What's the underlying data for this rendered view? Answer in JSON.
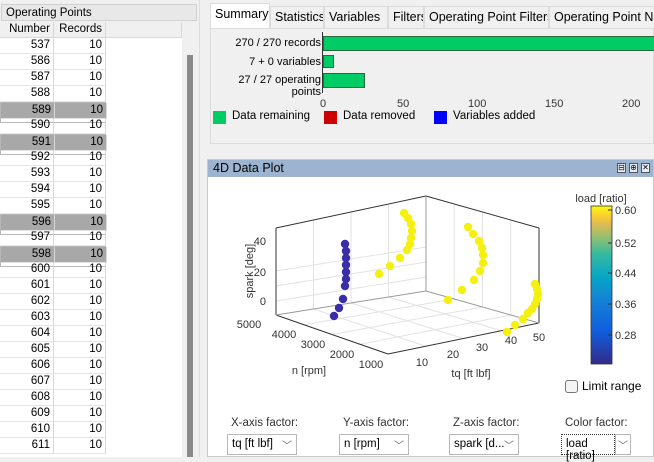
{
  "left_panel": {
    "title": "Operating Points",
    "columns": [
      "Number",
      "Records"
    ],
    "rows": [
      {
        "number": "537",
        "records": "10",
        "selected": false
      },
      {
        "number": "586",
        "records": "10",
        "selected": false
      },
      {
        "number": "587",
        "records": "10",
        "selected": false
      },
      {
        "number": "588",
        "records": "10",
        "selected": false
      },
      {
        "number": "589",
        "records": "10",
        "selected": true
      },
      {
        "number": "590",
        "records": "10",
        "selected": false
      },
      {
        "number": "591",
        "records": "10",
        "selected": true
      },
      {
        "number": "592",
        "records": "10",
        "selected": false
      },
      {
        "number": "593",
        "records": "10",
        "selected": false
      },
      {
        "number": "594",
        "records": "10",
        "selected": false
      },
      {
        "number": "595",
        "records": "10",
        "selected": false
      },
      {
        "number": "596",
        "records": "10",
        "selected": true
      },
      {
        "number": "597",
        "records": "10",
        "selected": false
      },
      {
        "number": "598",
        "records": "10",
        "selected": true
      },
      {
        "number": "600",
        "records": "10",
        "selected": false
      },
      {
        "number": "601",
        "records": "10",
        "selected": false
      },
      {
        "number": "602",
        "records": "10",
        "selected": false
      },
      {
        "number": "603",
        "records": "10",
        "selected": false
      },
      {
        "number": "604",
        "records": "10",
        "selected": false
      },
      {
        "number": "605",
        "records": "10",
        "selected": false
      },
      {
        "number": "606",
        "records": "10",
        "selected": false
      },
      {
        "number": "607",
        "records": "10",
        "selected": false
      },
      {
        "number": "608",
        "records": "10",
        "selected": false
      },
      {
        "number": "609",
        "records": "10",
        "selected": false
      },
      {
        "number": "610",
        "records": "10",
        "selected": false
      },
      {
        "number": "611",
        "records": "10",
        "selected": false
      }
    ]
  },
  "tabs": [
    {
      "label": "Summary",
      "active": true
    },
    {
      "label": "Statistics",
      "active": false
    },
    {
      "label": "Variables",
      "active": false
    },
    {
      "label": "Filters",
      "active": false
    },
    {
      "label": "Operating Point Filters",
      "active": false
    },
    {
      "label": "Operating Point No",
      "active": false
    }
  ],
  "summary": {
    "bars": [
      {
        "label": "270 / 270 records",
        "value": 270
      },
      {
        "label": "7 + 0 variables",
        "value": 7
      },
      {
        "label": "27 / 27 operating points",
        "value": 27
      }
    ],
    "ticks": [
      "0",
      "50",
      "100",
      "150",
      "200"
    ],
    "legend": [
      {
        "label": "Data remaining",
        "color": "#00cc66"
      },
      {
        "label": "Data removed",
        "color": "#cc0000"
      },
      {
        "label": "Variables added",
        "color": "#0000ff"
      }
    ]
  },
  "plot_panel": {
    "title": "4D Data Plot",
    "buttons": [
      "undock",
      "maximize",
      "close"
    ],
    "limit_range_label": "Limit range",
    "limit_range_checked": false,
    "factors": [
      {
        "label": "X-axis factor:",
        "value": "tq [ft lbf]"
      },
      {
        "label": "Y-axis factor:",
        "value": "n [rpm]"
      },
      {
        "label": "Z-axis factor:",
        "value": "spark [d..."
      },
      {
        "label": "Color factor:",
        "value": "load [ratio]"
      }
    ]
  },
  "chart_data": {
    "type": "scatter3d",
    "xlabel": "tq [ft lbf]",
    "ylabel": "n [rpm]",
    "zlabel": "spark [deg]",
    "x_ticks": [
      "10",
      "20",
      "30",
      "40",
      "50"
    ],
    "y_ticks": [
      "5000",
      "4000",
      "3000",
      "2000",
      "1000"
    ],
    "z_ticks": [
      "40",
      "20",
      "0"
    ],
    "colorbar": {
      "label": "load [ratio]",
      "ticks": [
        "0.60",
        "0.52",
        "0.44",
        "0.36",
        "0.28"
      ],
      "colormap": "parula"
    },
    "grid": true,
    "series": [
      {
        "color_value": 0.2,
        "color": "#3a2ea8",
        "points": 10
      },
      {
        "color_value": 0.6,
        "color": "#f5f00f",
        "points": 10
      },
      {
        "color_value": 0.6,
        "color": "#f5f00f",
        "points": 10
      },
      {
        "color_value": 0.6,
        "color": "#f5f00f",
        "points": 10
      }
    ]
  }
}
